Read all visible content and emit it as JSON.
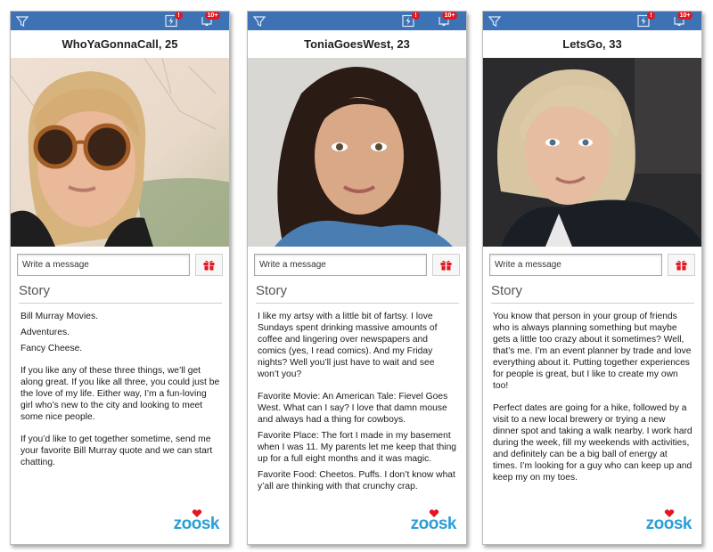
{
  "topbar": {
    "filter_icon": "filter-icon",
    "bolt_icon": "lightning-bolt-icon",
    "bolt_badge": "!",
    "bell_icon": "notification-bell-icon",
    "bell_badge": "10+"
  },
  "common": {
    "message_placeholder": "Write a message",
    "story_heading": "Story",
    "gift_icon": "gift-icon",
    "logo_text": "zoosk"
  },
  "colors": {
    "topbar": "#3d72b4",
    "badge": "#e4161f",
    "gift": "#e4161f",
    "logo": "#2a9fd8"
  },
  "profiles": [
    {
      "title": "WhoYaGonnaCall, 25",
      "photo_desc": "Blonde woman wearing tortoiseshell sunglasses outdoors in a park",
      "story": [
        "Bill Murray Movies.",
        "Adventures.",
        "Fancy Cheese.",
        "If you like any of these three things, we’ll get along great. If you like all three, you could just be the love of my life. Either way, I’m a fun-loving girl who’s new to the city and looking to meet some nice people.",
        "If you’d like to get together sometime, send me your favorite Bill Murray quote and we can start chatting."
      ]
    },
    {
      "title": "ToniaGoesWest, 23",
      "photo_desc": "Smiling woman with long dark hair wearing a denim shirt",
      "story": [
        "I like my artsy with a little bit of fartsy. I love Sundays spent drinking massive amounts of coffee and lingering over newspapers and comics (yes, I read comics). And my Friday nights? Well you’ll just have to wait and see won’t you?",
        "Favorite Movie: An American Tale: Fievel Goes West. What can I say? I love that damn mouse and always had a thing for cowboys.",
        "Favorite Place: The fort I made in my basement when I was 11. My parents let me keep that thing up for a full eight  months and it was magic.",
        "Favorite Food: Cheetos. Puffs. I don’t know what y’all are thinking with that crunchy crap."
      ]
    },
    {
      "title": "LetsGo, 33",
      "photo_desc": "Blonde woman in a dark jacket taking a selfie indoors",
      "story": [
        "You know that person in your group of friends who is always planning something but maybe gets a little too crazy about it sometimes? Well, that’s me. I’m an event planner by trade and love everything about it. Putting together experiences for people is great, but I like to create my own too!",
        "Perfect dates are going for a hike, followed by a visit to a new local brewery or trying a new dinner spot and taking a walk nearby. I work hard during the week, fill my weekends with activities, and definitely can be a big ball of energy at times. I’m looking for a guy who can keep up and keep my on my toes."
      ]
    }
  ]
}
